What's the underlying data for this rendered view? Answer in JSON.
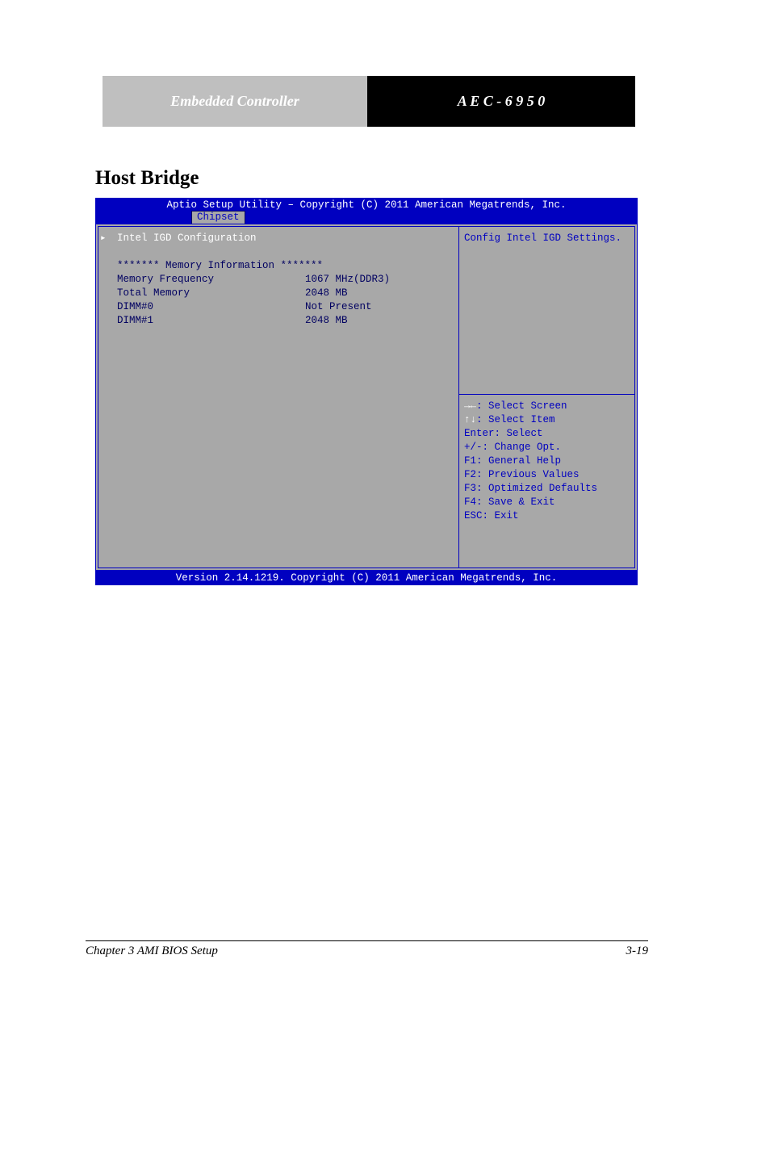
{
  "page": {
    "header_gray": "Embedded Controller",
    "header_black": "A E C - 6 9 5 0",
    "section_title": "Host Bridge",
    "footer_left": "Chapter 3 AMI BIOS Setup",
    "footer_right": "3-19"
  },
  "bios": {
    "title": "Aptio Setup Utility – Copyright (C) 2011 American Megatrends, Inc.",
    "tab": "Chipset",
    "selected_item": "Intel IGD Configuration",
    "mem_header": "******* Memory Information *******",
    "rows": [
      {
        "label": "Memory Frequency",
        "value": "1067 MHz(DDR3)"
      },
      {
        "label": "Total Memory",
        "value": "2048 MB"
      },
      {
        "label": "DIMM#0",
        "value": "Not Present"
      },
      {
        "label": "DIMM#1",
        "value": "2048 MB"
      }
    ],
    "help_text": "Config Intel IGD Settings.",
    "keys": {
      "k1a": "→←",
      "k1b": ": Select Screen",
      "k2a": "↑↓",
      "k2b": ": Select Item",
      "k3": "Enter: Select",
      "k4": "+/-: Change Opt.",
      "k5": "F1: General Help",
      "k6": "F2: Previous Values",
      "k7": "F3: Optimized Defaults",
      "k8": "F4: Save & Exit",
      "k9": "ESC: Exit"
    },
    "version": "Version 2.14.1219. Copyright (C) 2011 American Megatrends, Inc."
  }
}
